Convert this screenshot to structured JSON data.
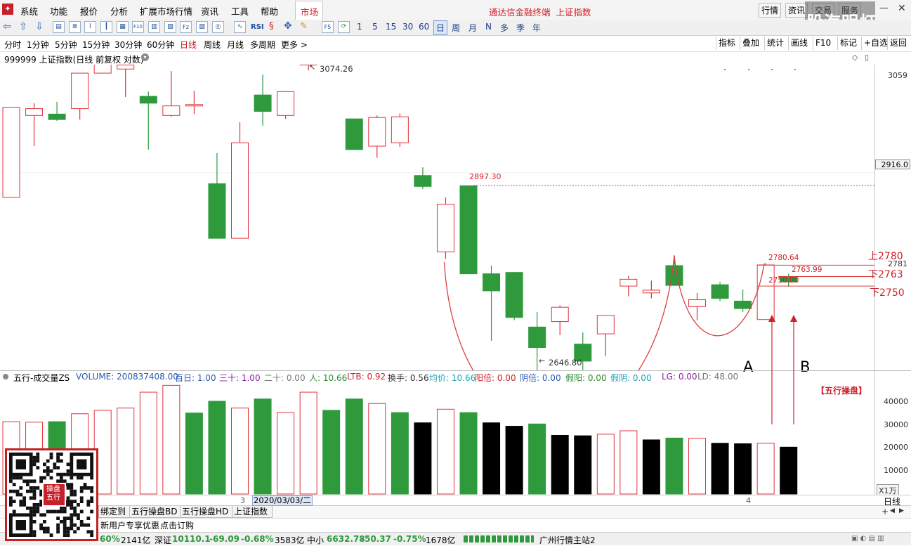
{
  "menu": {
    "items": [
      "系统",
      "功能",
      "报价",
      "分析",
      "扩展市场行情",
      "资讯",
      "工具",
      "帮助"
    ],
    "market_tab": "市场",
    "window_title": "通达信金融终端  上证指数",
    "right_buttons": [
      "行情",
      "资讯",
      "交易",
      "服务"
    ],
    "watermark": "股海明灯"
  },
  "toolbar": {
    "period_numbers": [
      "1",
      "5",
      "15",
      "30",
      "60"
    ],
    "period_chars": [
      "日",
      "周",
      "月",
      "N",
      "多",
      "季",
      "年"
    ],
    "icon_texts": {
      "f10": "F10",
      "fz": "Fz",
      "rsi": "RSI",
      "f5": "F5"
    }
  },
  "periods": {
    "items": [
      "分时",
      "1分钟",
      "5分钟",
      "15分钟",
      "30分钟",
      "60分钟",
      "日线",
      "周线",
      "月线",
      "多周期",
      "更多 >"
    ],
    "active": "日线",
    "right_items": [
      "指标",
      "叠加",
      "统计",
      "画线",
      "F10",
      "标记",
      "+自选",
      "返回"
    ]
  },
  "main_chart": {
    "title": "999999 上证指数(日线 前复权 对数)",
    "price_ticks": [
      "3059",
      "2916.0",
      "2781"
    ],
    "annotations": {
      "high": "3074.26",
      "low": "2646.80",
      "level_2897": "2897.30",
      "level_2780": "2780.64",
      "level_2763": "2763.99",
      "level_2750": "2750.00",
      "up_2780": "上2780",
      "down_2763": "下2763",
      "down_2750": "下2750",
      "marker_a": "A",
      "marker_b": "B"
    },
    "colors": {
      "up": "#e0323c",
      "down": "#2e9a3c",
      "dark": "#000000",
      "curve": "#d94040"
    },
    "candles": [
      {
        "o": 2880,
        "c": 3012,
        "h": 3012,
        "l": 2880
      },
      {
        "o": 3000,
        "c": 3010,
        "h": 3018,
        "l": 2955
      },
      {
        "o": 3002,
        "c": 2994,
        "h": 3020,
        "l": 2992
      },
      {
        "o": 3010,
        "c": 3062,
        "h": 3062,
        "l": 2994
      },
      {
        "o": 3062,
        "c": 3100,
        "h": 3128,
        "l": 3062
      },
      {
        "o": 3068,
        "c": 3074,
        "h": 3088,
        "l": 3027
      },
      {
        "o": 3028,
        "c": 3018,
        "h": 3035,
        "l": 2950
      },
      {
        "o": 3000,
        "c": 3014,
        "h": 3065,
        "l": 2998
      },
      {
        "o": 3016,
        "c": 3016,
        "h": 3036,
        "l": 3002
      },
      {
        "o": 2900,
        "c": 2820,
        "h": 2945,
        "l": 2820
      },
      {
        "o": 2820,
        "c": 2960,
        "h": 2990,
        "l": 2820
      },
      {
        "o": 3030,
        "c": 3006,
        "h": 3060,
        "l": 2985
      },
      {
        "o": 3000,
        "c": 3035,
        "h": 3035,
        "l": 2995
      },
      {
        "o": 3074,
        "c": 3128,
        "h": 3144,
        "l": 3066
      },
      {
        "o": 3098,
        "c": 3088,
        "h": 3108,
        "l": 3083
      },
      {
        "o": 2995,
        "c": 2950,
        "h": 2995,
        "l": 2950
      },
      {
        "o": 2955,
        "c": 2997,
        "h": 3000,
        "l": 2938
      },
      {
        "o": 2960,
        "c": 2998,
        "h": 3003,
        "l": 2954
      },
      {
        "o": 2912,
        "c": 2896,
        "h": 2924,
        "l": 2892
      },
      {
        "o": 2800,
        "c": 2870,
        "h": 2880,
        "l": 2790
      },
      {
        "o": 2897,
        "c": 2768,
        "h": 2897,
        "l": 2768
      },
      {
        "o": 2768,
        "c": 2743,
        "h": 2780,
        "l": 2670
      },
      {
        "o": 2770,
        "c": 2704,
        "h": 2770,
        "l": 2700
      },
      {
        "o": 2690,
        "c": 2660,
        "h": 2712,
        "l": 2600
      },
      {
        "o": 2698,
        "c": 2719,
        "h": 2722,
        "l": 2678
      },
      {
        "o": 2665,
        "c": 2640,
        "h": 2682,
        "l": 2627
      },
      {
        "o": 2680,
        "c": 2707,
        "h": 2707,
        "l": 2647
      },
      {
        "o": 2750,
        "c": 2760,
        "h": 2765,
        "l": 2735
      },
      {
        "o": 2740,
        "c": 2744,
        "h": 2758,
        "l": 2732
      },
      {
        "o": 2780,
        "c": 2751,
        "h": 2795,
        "l": 2751
      },
      {
        "o": 2720,
        "c": 2730,
        "h": 2740,
        "l": 2700
      },
      {
        "o": 2752,
        "c": 2732,
        "h": 2756,
        "l": 2728
      },
      {
        "o": 2728,
        "c": 2717,
        "h": 2745,
        "l": 2712
      },
      {
        "o": 2701,
        "c": 2781,
        "h": 2784,
        "l": 2701
      },
      {
        "o": 2764,
        "c": 2756,
        "h": 2768,
        "l": 2749
      }
    ]
  },
  "volume_panel": {
    "header": {
      "name": "五行-成交量ZS",
      "volume": "VOLUME: 200837408.00",
      "baiyi": "百日: 1.00",
      "sanshi": "三十: 1.00",
      "ershi": "二十: 0.00",
      "ren": "人: 10.66",
      "ltb": "LTB: 0.92",
      "huanshou": "换手: 0.56",
      "junjia": "均价: 10.66",
      "yangbei": "阳倍: 0.00",
      "yinbei": "阴倍: 0.00",
      "jiayang": "假阳: 0.00",
      "jiayin": "假阴: 0.00",
      "lg": "LG: 0.00",
      "ld": "LD: 48.00"
    },
    "label": "【五行操盘】",
    "ticks": [
      "40000",
      "30000",
      "20000",
      "10000"
    ],
    "unit": "X1万",
    "bars": [
      {
        "v": 31000,
        "c": "up"
      },
      {
        "v": 30800,
        "c": "up"
      },
      {
        "v": 31000,
        "c": "down"
      },
      {
        "v": 34500,
        "c": "up"
      },
      {
        "v": 36000,
        "c": "up"
      },
      {
        "v": 37000,
        "c": "up"
      },
      {
        "v": 44000,
        "c": "up"
      },
      {
        "v": 47000,
        "c": "up"
      },
      {
        "v": 34800,
        "c": "down"
      },
      {
        "v": 40000,
        "c": "down"
      },
      {
        "v": 37000,
        "c": "up"
      },
      {
        "v": 41000,
        "c": "down"
      },
      {
        "v": 35000,
        "c": "up"
      },
      {
        "v": 44000,
        "c": "up"
      },
      {
        "v": 36000,
        "c": "down"
      },
      {
        "v": 41000,
        "c": "down"
      },
      {
        "v": 39000,
        "c": "up"
      },
      {
        "v": 35000,
        "c": "down"
      },
      {
        "v": 30500,
        "c": "dark"
      },
      {
        "v": 36500,
        "c": "up"
      },
      {
        "v": 35000,
        "c": "down"
      },
      {
        "v": 30500,
        "c": "dark"
      },
      {
        "v": 29000,
        "c": "dark"
      },
      {
        "v": 30000,
        "c": "down"
      },
      {
        "v": 25000,
        "c": "dark"
      },
      {
        "v": 24800,
        "c": "dark"
      },
      {
        "v": 25500,
        "c": "up"
      },
      {
        "v": 27000,
        "c": "up"
      },
      {
        "v": 23000,
        "c": "dark"
      },
      {
        "v": 23800,
        "c": "down"
      },
      {
        "v": 23700,
        "c": "up"
      },
      {
        "v": 21500,
        "c": "dark"
      },
      {
        "v": 21300,
        "c": "dark"
      },
      {
        "v": 21500,
        "c": "up"
      },
      {
        "v": 19800,
        "c": "dark"
      }
    ]
  },
  "date_axis": {
    "month_3": "3",
    "date_label": "2020/03/03/二",
    "month_4": "4",
    "period": "日线"
  },
  "bottom_tabs": [
    "绑定到",
    "五行操盘BD",
    "五行操盘HD",
    "上证指数"
  ],
  "promo": {
    "text": "新用户专享优惠",
    "link": "点击订购"
  },
  "status": {
    "sh_pct": "60%",
    "sh_amt": "2141亿",
    "sz_label": "深证",
    "sz_val": "10110.1",
    "sz_chg": "-69.09",
    "sz_pct": "-0.68%",
    "sz_amt": "3583亿",
    "zx_label": "中小",
    "zx_val": "6632.78",
    "zx_chg": "-50.37",
    "zx_pct": "-0.75%",
    "zx_amt": "1678亿",
    "server": "广州行情主站2"
  },
  "qr": {
    "badge": "操盘 五行"
  }
}
